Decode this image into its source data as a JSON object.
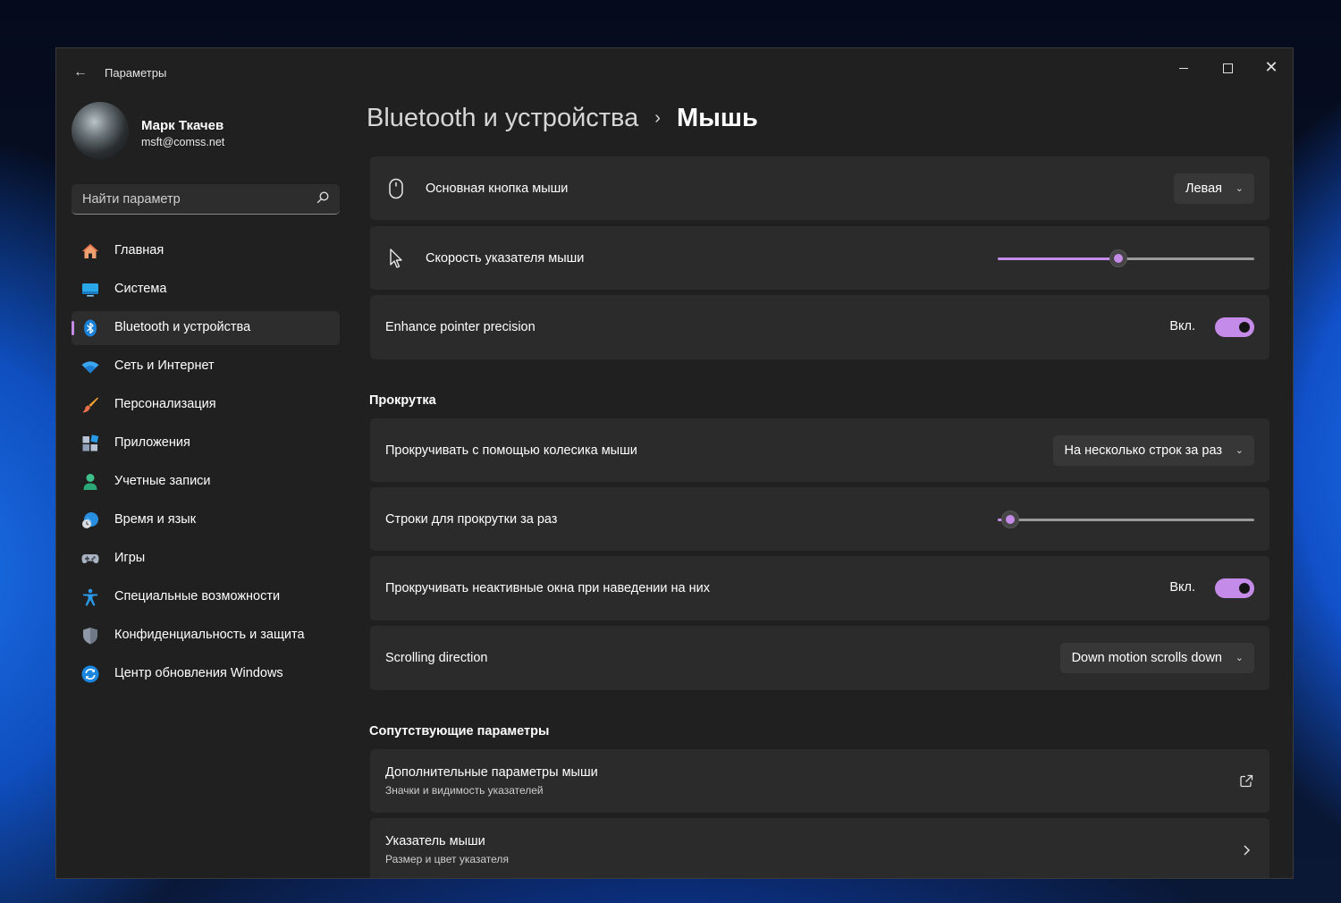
{
  "window": {
    "title": "Параметры",
    "accent": "#c48ce8"
  },
  "user": {
    "name": "Марк Ткачев",
    "email": "msft@comss.net"
  },
  "search": {
    "placeholder": "Найти параметр"
  },
  "sidebar": {
    "items": [
      {
        "label": "Главная",
        "icon": "home-icon"
      },
      {
        "label": "Система",
        "icon": "system-icon"
      },
      {
        "label": "Bluetooth и устройства",
        "icon": "bluetooth-icon",
        "active": true
      },
      {
        "label": "Сеть и Интернет",
        "icon": "wifi-icon"
      },
      {
        "label": "Персонализация",
        "icon": "brush-icon"
      },
      {
        "label": "Приложения",
        "icon": "apps-icon"
      },
      {
        "label": "Учетные записи",
        "icon": "person-icon"
      },
      {
        "label": "Время и язык",
        "icon": "globe-clock-icon"
      },
      {
        "label": "Игры",
        "icon": "gamepad-icon"
      },
      {
        "label": "Специальные возможности",
        "icon": "accessibility-icon"
      },
      {
        "label": "Конфиденциальность и защита",
        "icon": "shield-icon"
      },
      {
        "label": "Центр обновления Windows",
        "icon": "update-icon"
      }
    ]
  },
  "breadcrumb": {
    "parent": "Bluetooth и устройства",
    "separator": "›",
    "current": "Мышь"
  },
  "mouse": {
    "primary_button": {
      "label": "Основная кнопка мыши",
      "value": "Левая"
    },
    "pointer_speed": {
      "label": "Скорость указателя мыши",
      "value_fraction": 0.47
    },
    "pointer_precision": {
      "label": "Enhance pointer precision",
      "state": "Вкл."
    }
  },
  "scrolling": {
    "header": "Прокрутка",
    "wheel": {
      "label": "Прокручивать с помощью колесика мыши",
      "value": "На несколько строк за раз"
    },
    "lines": {
      "label": "Строки для прокрутки за раз",
      "value_fraction": 0.05
    },
    "inactive": {
      "label": "Прокручивать неактивные окна при наведении на них",
      "state": "Вкл."
    },
    "direction": {
      "label": "Scrolling direction",
      "value": "Down motion scrolls down"
    }
  },
  "related": {
    "header": "Сопутствующие параметры",
    "additional": {
      "title": "Дополнительные параметры мыши",
      "subtitle": "Значки и видимость указателей"
    },
    "pointer": {
      "title": "Указатель мыши",
      "subtitle": "Размер и цвет указателя"
    }
  }
}
